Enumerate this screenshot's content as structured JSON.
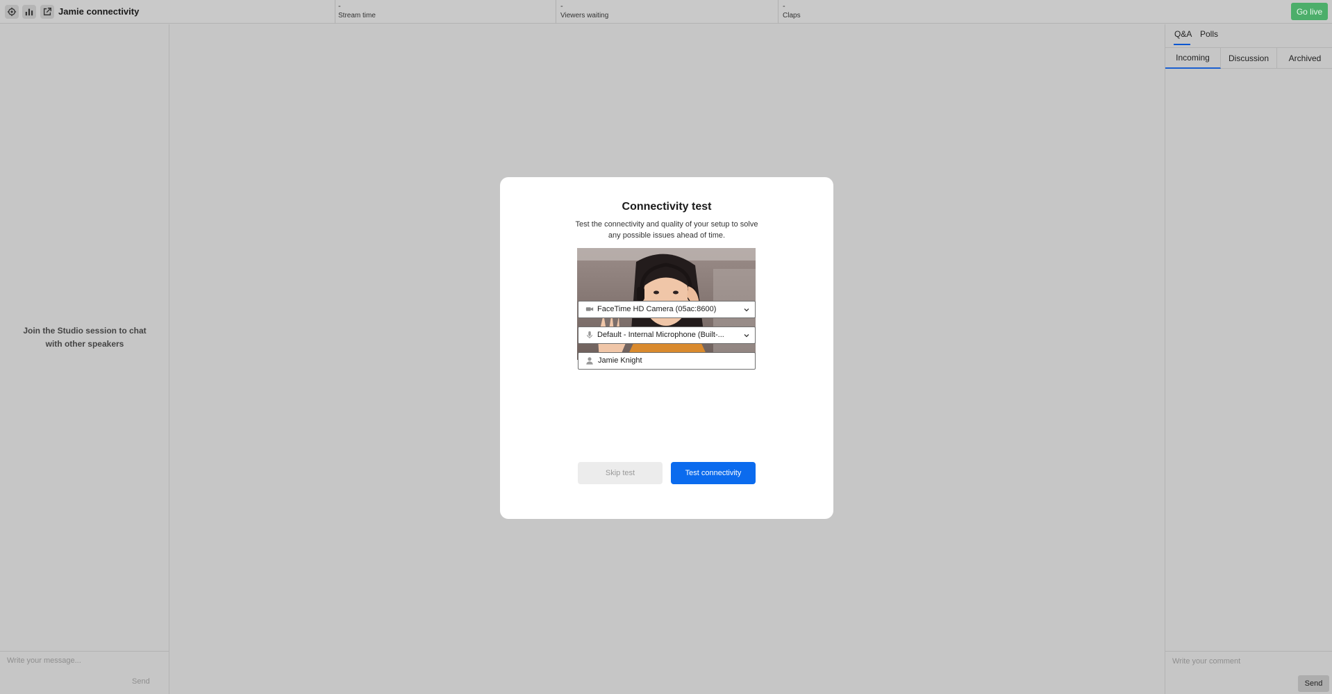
{
  "topbar": {
    "icons": [
      "gear-icon",
      "bar-chart-icon",
      "external-link-icon"
    ],
    "title": "Jamie connectivity",
    "stats": [
      {
        "value": "-",
        "label": "Stream time"
      },
      {
        "value": "-",
        "label": "Viewers waiting"
      },
      {
        "value": "-",
        "label": "Claps"
      }
    ],
    "go_live_label": "Go live",
    "go_live_color": "#4cae6a"
  },
  "left_panel": {
    "message": "Join the Studio session to chat with other speakers",
    "input_placeholder": "Write your message...",
    "send_label": "Send"
  },
  "right_panel": {
    "tabs": [
      {
        "label": "Q&A"
      },
      {
        "label": "Polls"
      }
    ],
    "active_tab": "Q&A",
    "subtabs": [
      {
        "label": "Incoming"
      },
      {
        "label": "Discussion"
      },
      {
        "label": "Archived"
      }
    ],
    "active_subtab": "Incoming",
    "input_placeholder": "Write your comment",
    "send_label": "Send"
  },
  "modal": {
    "title": "Connectivity test",
    "description": "Test the connectivity and quality of your setup to solve any possible issues ahead of time.",
    "camera": {
      "icon": "video-camera-icon",
      "value": "FaceTime HD Camera (05ac:8600)"
    },
    "microphone": {
      "icon": "microphone-icon",
      "value": "Default - Internal Microphone (Built-..."
    },
    "name": {
      "icon": "person-icon",
      "value": "Jamie Knight"
    },
    "skip_label": "Skip test",
    "test_label": "Test connectivity",
    "accent_color": "#0b6bee"
  }
}
